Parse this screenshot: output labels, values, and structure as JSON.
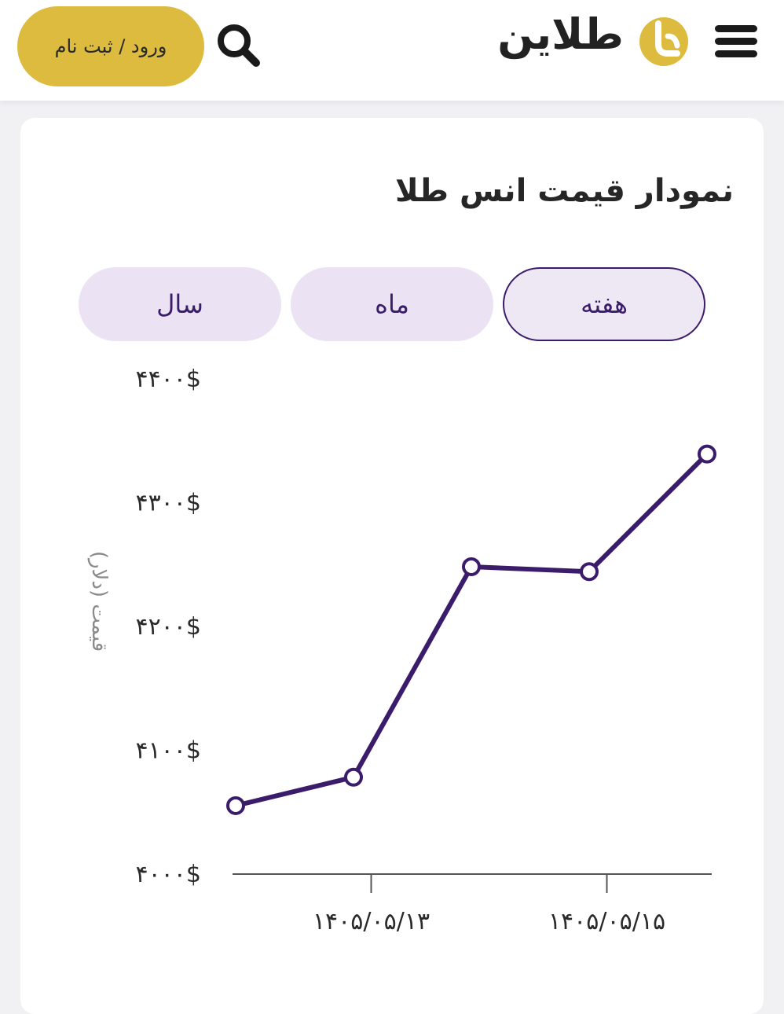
{
  "header": {
    "logo_text": "طلاین",
    "login_label": "ورود / ثبت نام",
    "icons": {
      "menu": "hamburger-menu-icon",
      "search": "search-icon",
      "logo": "talain-logo-mark"
    },
    "colors": {
      "brand_gold": "#dcbb3f",
      "text": "#1a1a1a"
    }
  },
  "card": {
    "title": "نمودار قیمت انس طلا",
    "tabs": [
      {
        "label": "هفته",
        "active": true
      },
      {
        "label": "ماه",
        "active": false
      },
      {
        "label": "سال",
        "active": false
      }
    ]
  },
  "chart_data": {
    "type": "line",
    "title": "",
    "ylabel": "قیمت (دلار)",
    "xlabel": "",
    "ylim": [
      4000,
      4400
    ],
    "y_ticks": [
      {
        "value": 4400,
        "label": "۴۴۰۰$"
      },
      {
        "value": 4300,
        "label": "۴۳۰۰$"
      },
      {
        "value": 4200,
        "label": "۴۲۰۰$"
      },
      {
        "value": 4100,
        "label": "۴۱۰۰$"
      },
      {
        "value": 4000,
        "label": "۴۰۰۰$"
      }
    ],
    "x_ticks": [
      {
        "index": 1.15,
        "label": "۱۴۰۵/۰۵/۱۳"
      },
      {
        "index": 3.15,
        "label": "۱۴۰۵/۰۵/۱۵"
      }
    ],
    "points": [
      4054,
      4077,
      4247,
      4243,
      4338
    ],
    "line_color": "#3b1c6b",
    "grid": false
  }
}
